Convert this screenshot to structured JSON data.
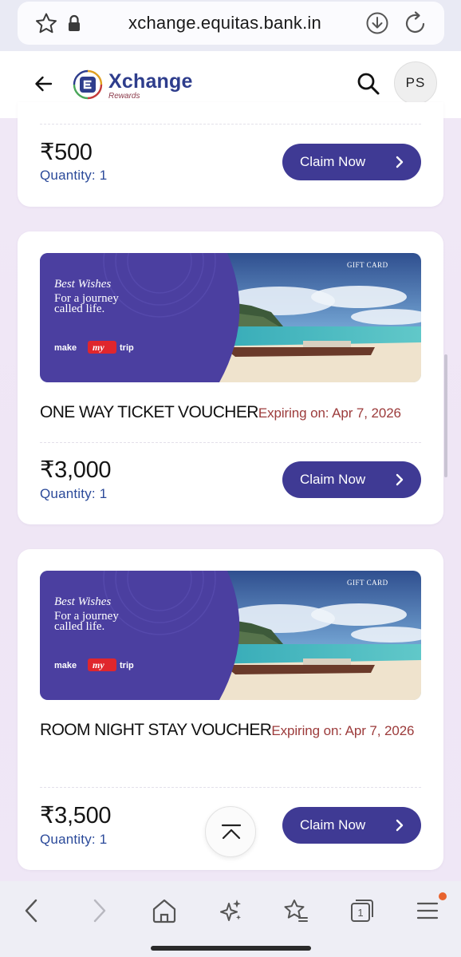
{
  "browser": {
    "url": "xchange.equitas.bank.in"
  },
  "header": {
    "logo_title": "Xchange",
    "logo_subtitle": "Rewards",
    "avatar_initials": "PS"
  },
  "banner": {
    "greeting": "Best Wishes",
    "line1": "For a journey",
    "line2": "called life.",
    "tag": "GIFT CARD",
    "brand_left": "make",
    "brand_mid": "my",
    "brand_right": "trip"
  },
  "vouchers": [
    {
      "price": "₹500",
      "quantity": "Quantity: 1",
      "button": "Claim Now"
    },
    {
      "title": "ONE WAY TICKET VOUCHER",
      "expiry": "Expiring on: Apr 7, 2026",
      "price": "₹3,000",
      "quantity": "Quantity: 1",
      "button": "Claim Now"
    },
    {
      "title": "ROOM NIGHT STAY VOUCHER",
      "expiry": "Expiring on: Apr 7, 2026",
      "price": "₹3,500",
      "quantity": "Quantity: 1",
      "button": "Claim Now"
    }
  ],
  "colors": {
    "accent_button": "#3f3a94",
    "expiry_text": "#9c3b3b",
    "quantity_text": "#2b4a9a",
    "logo_blue": "#2e3d8c",
    "notification_dot": "#e8632e"
  },
  "icons": {
    "bookmark": "star-icon",
    "secure": "lock-icon",
    "download": "download-icon",
    "reload": "reload-icon",
    "back": "arrow-left-icon",
    "search": "search-icon",
    "claim": "chevron-right-icon",
    "scroll_top": "chevron-up-icon",
    "nav": [
      "back-icon",
      "forward-icon",
      "home-icon",
      "sparkle-icon",
      "favorites-icon",
      "tabs-icon",
      "menu-icon"
    ]
  },
  "bottom_nav": {
    "tab_count": "1"
  }
}
